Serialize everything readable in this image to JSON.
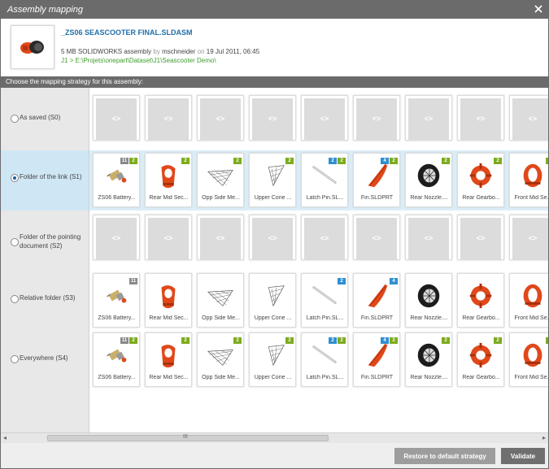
{
  "dialog": {
    "title": "Assembly mapping"
  },
  "assembly": {
    "name": "_ZS06 SEASCOOTER FINAL.SLDASM",
    "size_type": "5 MB SOLIDWORKS assembly",
    "by_word": "by",
    "author": "mschneider",
    "on_word": "on",
    "date": "19 Jul 2011, 06:45",
    "path": "J1 > E:\\Projets\\onepart\\Dataset\\J1\\Seascooter Demo\\"
  },
  "strategy_header": "Choose the mapping strategy for this assembly:",
  "placeholder_text": "<>",
  "options": [
    {
      "label": "As saved (S0)"
    },
    {
      "label": "Folder of the link (S1)"
    },
    {
      "label": "Folder of the pointing document (S2)"
    },
    {
      "label": "Relative folder (S3)"
    },
    {
      "label": "Everywhere (S4)"
    }
  ],
  "parts": [
    {
      "name": "ZS06 Battery...",
      "icon": "battery-part-icon"
    },
    {
      "name": "Rear Mid Sec...",
      "icon": "rear-mid-section-part-icon"
    },
    {
      "name": "Opp Side Me...",
      "icon": "mesh-part-icon"
    },
    {
      "name": "Upper Cone ...",
      "icon": "cone-mesh-part-icon"
    },
    {
      "name": "Latch Pin.SL...",
      "icon": "pin-part-icon"
    },
    {
      "name": "Fin.SLDPRT",
      "icon": "fin-part-icon"
    },
    {
      "name": "Rear Nozzle....",
      "icon": "nozzle-part-icon"
    },
    {
      "name": "Rear Gearbo...",
      "icon": "gearbox-part-icon"
    },
    {
      "name": "Front Mid Se...",
      "icon": "front-mid-section-part-icon"
    }
  ],
  "badge_sets": {
    "s1": [
      [
        [
          "11",
          "grey"
        ],
        [
          "2",
          "green"
        ]
      ],
      [
        [
          "2",
          "green"
        ]
      ],
      [
        [
          "2",
          "green"
        ]
      ],
      [
        [
          "2",
          "green"
        ]
      ],
      [
        [
          "2",
          "blue"
        ],
        [
          "2",
          "green"
        ]
      ],
      [
        [
          "4",
          "blue"
        ],
        [
          "2",
          "green"
        ]
      ],
      [
        [
          "2",
          "green"
        ]
      ],
      [
        [
          "2",
          "green"
        ]
      ],
      [
        [
          "2",
          "green"
        ]
      ]
    ],
    "s3": [
      [
        [
          "11",
          "grey"
        ]
      ],
      [],
      [],
      [],
      [
        [
          "2",
          "blue"
        ]
      ],
      [
        [
          "4",
          "blue"
        ]
      ],
      [],
      [],
      []
    ],
    "s4": [
      [
        [
          "11",
          "grey"
        ],
        [
          "2",
          "green"
        ]
      ],
      [
        [
          "2",
          "green"
        ]
      ],
      [
        [
          "2",
          "green"
        ]
      ],
      [
        [
          "2",
          "green"
        ]
      ],
      [
        [
          "2",
          "blue"
        ],
        [
          "2",
          "green"
        ]
      ],
      [
        [
          "4",
          "blue"
        ],
        [
          "2",
          "green"
        ]
      ],
      [
        [
          "2",
          "green"
        ]
      ],
      [
        [
          "2",
          "green"
        ]
      ],
      [
        [
          "2",
          "green"
        ]
      ]
    ]
  },
  "colors": {
    "green": "#7dab1e",
    "blue": "#2f8fd0",
    "grey": "#888888",
    "orange": "#e0481a"
  },
  "scrollbar": {
    "grip": "III"
  },
  "buttons": {
    "restore": "Restore to default strategy",
    "validate": "Validate"
  }
}
